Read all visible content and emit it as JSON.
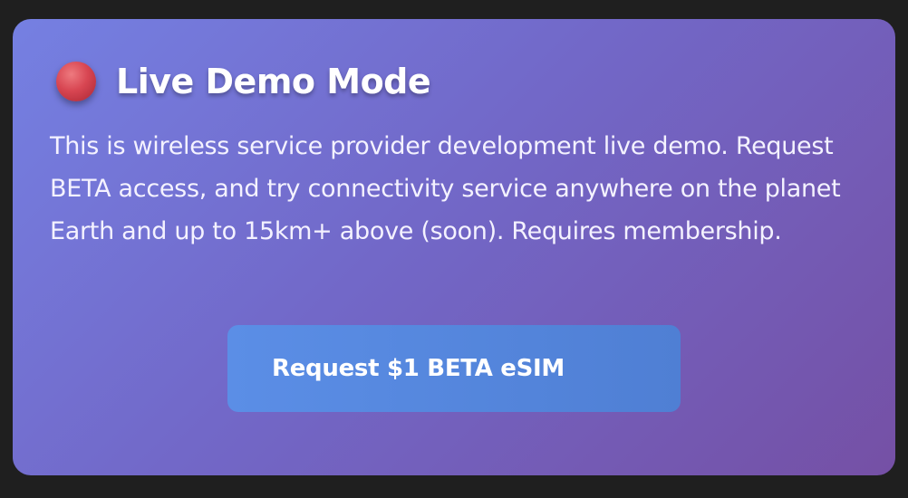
{
  "card": {
    "title": "Live Demo Mode",
    "status_icon": "red-dot-icon",
    "description": "This is wireless service provider development live demo. Request BETA access, and try connectivity service anywhere on the planet Earth and up to 15km+ above (soon). Requires membership.",
    "button_label": "Request $1 BETA eSIM"
  },
  "colors": {
    "page_background": "#1f1f1f",
    "card_gradient_start": "#7580e2",
    "card_gradient_end": "#7550a5",
    "button": "#5b8ee6",
    "status_dot": "#d84652"
  }
}
